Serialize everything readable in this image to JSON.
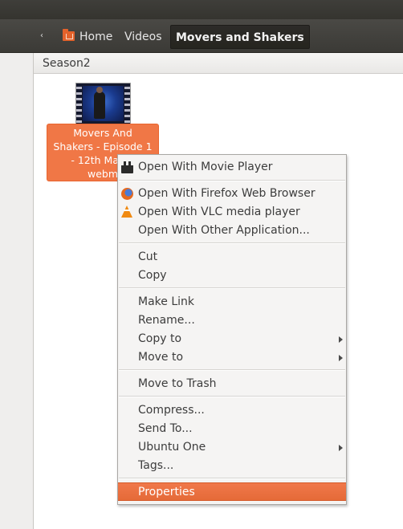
{
  "breadcrumb": {
    "back": "‹",
    "home": "Home",
    "videos": "Videos",
    "current": "Movers and Shakers"
  },
  "path_header": "Season2",
  "file": {
    "name_lines": [
      "Movers And",
      "Shakers - Episode 1",
      "- 12th March",
      "webm"
    ]
  },
  "context_menu": {
    "open_with_movie_player": "Open With Movie Player",
    "open_with_firefox": "Open With Firefox Web Browser",
    "open_with_vlc": "Open With VLC media player",
    "open_with_other": "Open With Other Application...",
    "cut": "Cut",
    "copy": "Copy",
    "make_link": "Make Link",
    "rename": "Rename...",
    "copy_to": "Copy to",
    "move_to": "Move to",
    "move_to_trash": "Move to Trash",
    "compress": "Compress...",
    "send_to": "Send To...",
    "ubuntu_one": "Ubuntu One",
    "tags": "Tags...",
    "properties": "Properties"
  },
  "colors": {
    "accent": "#f07746",
    "selection": "#e56a38",
    "toolbar": "#3b3a36"
  }
}
